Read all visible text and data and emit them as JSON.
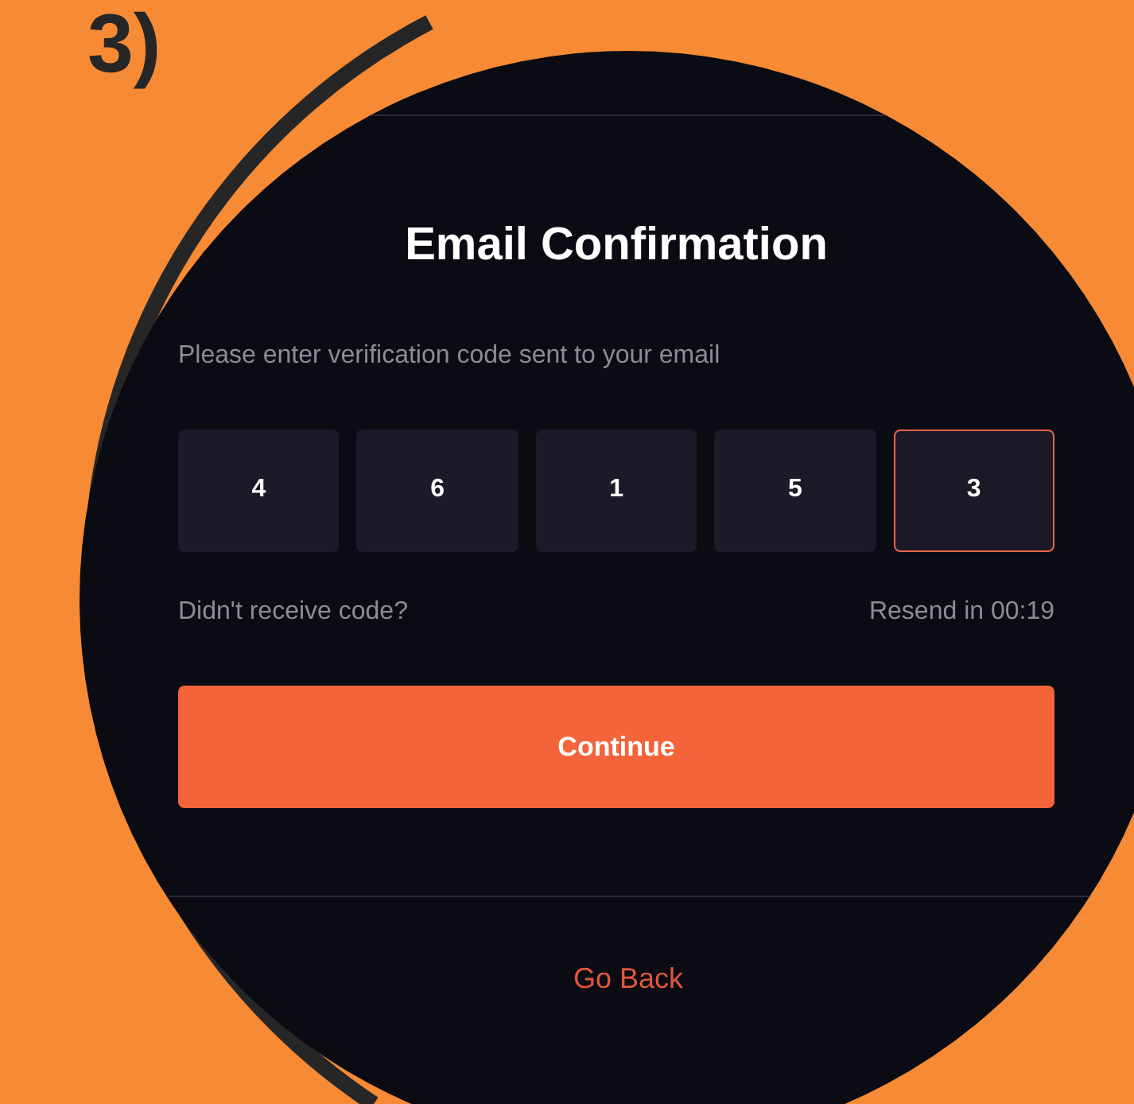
{
  "step_label": "3)",
  "title": "Email Confirmation",
  "subtitle": "Please enter verification code sent to your email",
  "code_digits": [
    {
      "digit": "4",
      "selected": false
    },
    {
      "digit": "6",
      "selected": false
    },
    {
      "digit": "1",
      "selected": false
    },
    {
      "digit": "5",
      "selected": false
    },
    {
      "digit": "3",
      "selected": true
    }
  ],
  "resend_row": {
    "hint": "Didn't receive code?",
    "timer": "Resend in 00:19"
  },
  "continue_button": "Continue",
  "back_link": "Go Back"
}
